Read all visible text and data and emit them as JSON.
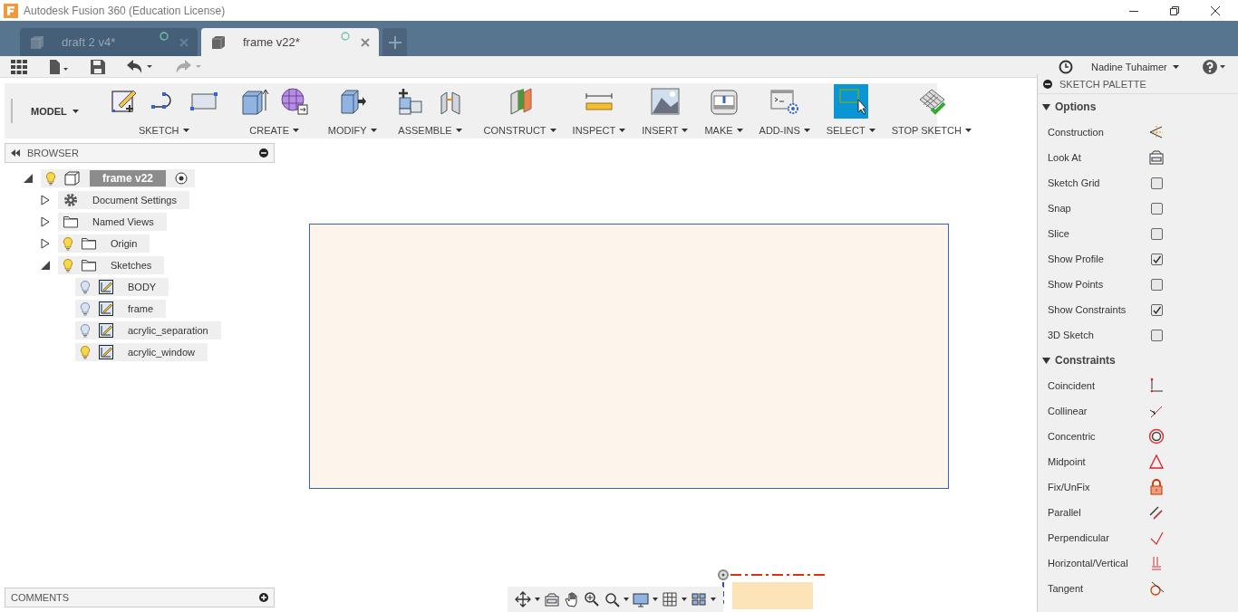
{
  "window": {
    "title": "Autodesk Fusion 360 (Education License)"
  },
  "tabs": [
    {
      "label": "draft 2 v4*",
      "selected": false
    },
    {
      "label": "frame v22*",
      "selected": true
    }
  ],
  "user": {
    "name": "Nadine Tuhaimer"
  },
  "workspace": {
    "label": "MODEL"
  },
  "toolbar": [
    {
      "label": "SKETCH",
      "active": false
    },
    {
      "label": "CREATE",
      "active": false
    },
    {
      "label": "MODIFY",
      "active": false
    },
    {
      "label": "ASSEMBLE",
      "active": false
    },
    {
      "label": "CONSTRUCT",
      "active": false
    },
    {
      "label": "INSPECT",
      "active": false
    },
    {
      "label": "INSERT",
      "active": false
    },
    {
      "label": "MAKE",
      "active": false
    },
    {
      "label": "ADD-INS",
      "active": false
    },
    {
      "label": "SELECT",
      "active": true
    },
    {
      "label": "STOP SKETCH",
      "active": false
    }
  ],
  "browser": {
    "title": "BROWSER",
    "tree": [
      {
        "label": "frame v22",
        "kind": "component",
        "selected": true,
        "expanded": true,
        "visible": true,
        "children": [
          {
            "label": "Document Settings",
            "kind": "settings",
            "selected": false,
            "expanded": false
          },
          {
            "label": "Named Views",
            "kind": "folder",
            "selected": false,
            "expanded": false
          },
          {
            "label": "Origin",
            "kind": "folder",
            "selected": false,
            "expanded": false,
            "visible": true
          },
          {
            "label": "Sketches",
            "kind": "folder",
            "selected": false,
            "expanded": true,
            "visible": true,
            "children": [
              {
                "label": "BODY",
                "kind": "sketch",
                "selected": false,
                "visible": false
              },
              {
                "label": "frame",
                "kind": "sketch",
                "selected": false,
                "visible": false
              },
              {
                "label": "acrylic_separation",
                "kind": "sketch",
                "selected": false,
                "visible": false
              },
              {
                "label": "acrylic_window",
                "kind": "sketch",
                "selected": false,
                "visible": true
              }
            ]
          }
        ]
      }
    ]
  },
  "comments": {
    "title": "COMMENTS"
  },
  "palette": {
    "title": "SKETCH PALETTE",
    "sections": [
      {
        "title": "Options",
        "expanded": true,
        "items": [
          {
            "label": "Construction",
            "kind": "button"
          },
          {
            "label": "Look At",
            "kind": "button"
          },
          {
            "label": "Sketch Grid",
            "kind": "checkbox",
            "checked": false
          },
          {
            "label": "Snap",
            "kind": "checkbox",
            "checked": false
          },
          {
            "label": "Slice",
            "kind": "checkbox",
            "checked": false
          },
          {
            "label": "Show Profile",
            "kind": "checkbox",
            "checked": true
          },
          {
            "label": "Show Points",
            "kind": "checkbox",
            "checked": false
          },
          {
            "label": "Show Constraints",
            "kind": "checkbox",
            "checked": true
          },
          {
            "label": "3D Sketch",
            "kind": "checkbox",
            "checked": false
          }
        ]
      },
      {
        "title": "Constraints",
        "expanded": true,
        "items": [
          {
            "label": "Coincident",
            "kind": "button"
          },
          {
            "label": "Collinear",
            "kind": "button"
          },
          {
            "label": "Concentric",
            "kind": "button"
          },
          {
            "label": "Midpoint",
            "kind": "button"
          },
          {
            "label": "Fix/UnFix",
            "kind": "button"
          },
          {
            "label": "Parallel",
            "kind": "button"
          },
          {
            "label": "Perpendicular",
            "kind": "button"
          },
          {
            "label": "Horizontal/Vertical",
            "kind": "button"
          },
          {
            "label": "Tangent",
            "kind": "button"
          }
        ]
      }
    ]
  }
}
